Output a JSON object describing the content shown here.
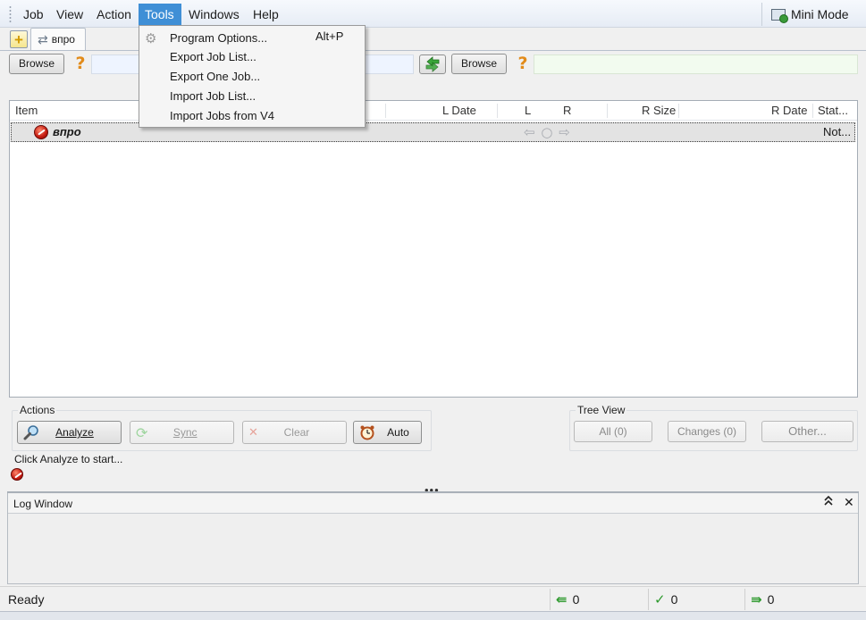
{
  "menubar": {
    "items": [
      "Job",
      "View",
      "Action",
      "Tools",
      "Windows",
      "Help"
    ],
    "open_menu": "Tools",
    "mini_mode_label": "Mini Mode"
  },
  "tabs": {
    "add_label": "+",
    "job_tab_label": "впро"
  },
  "paths": {
    "left_browse": "Browse",
    "right_browse": "Browse",
    "left_help": "?",
    "right_help": "?"
  },
  "list": {
    "columns": [
      "Item",
      "L Date",
      "L",
      "R",
      "R Size",
      "R Date",
      "Stat..."
    ],
    "rows": [
      {
        "name": "впро",
        "direction": "⇦ ○ ⇨",
        "status": "Not..."
      }
    ]
  },
  "actions": {
    "title": "Actions",
    "analyze": "Analyze",
    "sync": "Sync",
    "clear": "Clear",
    "auto": "Auto",
    "hint": "Click Analyze to start..."
  },
  "tree_view": {
    "title": "Tree View",
    "all": "All (0)",
    "changes": "Changes (0)",
    "other": "Other..."
  },
  "log": {
    "title": "Log Window",
    "collapse": "⌃⌃",
    "close": "✕"
  },
  "status": {
    "text": "Ready",
    "left_count": "0",
    "ok_count": "0",
    "right_count": "0"
  },
  "tools_menu": {
    "items": [
      {
        "label": "Program Options...",
        "shortcut": "Alt+P"
      },
      {
        "label": "Export Job List..."
      },
      {
        "label": "Export One Job..."
      },
      {
        "label": "Import Job List..."
      },
      {
        "label": "Import Jobs from V4"
      }
    ]
  },
  "colors": {
    "menu_highlight": "#3f8fd6",
    "accent_green": "#2e9a2e",
    "help_orange": "#e28b1a"
  }
}
